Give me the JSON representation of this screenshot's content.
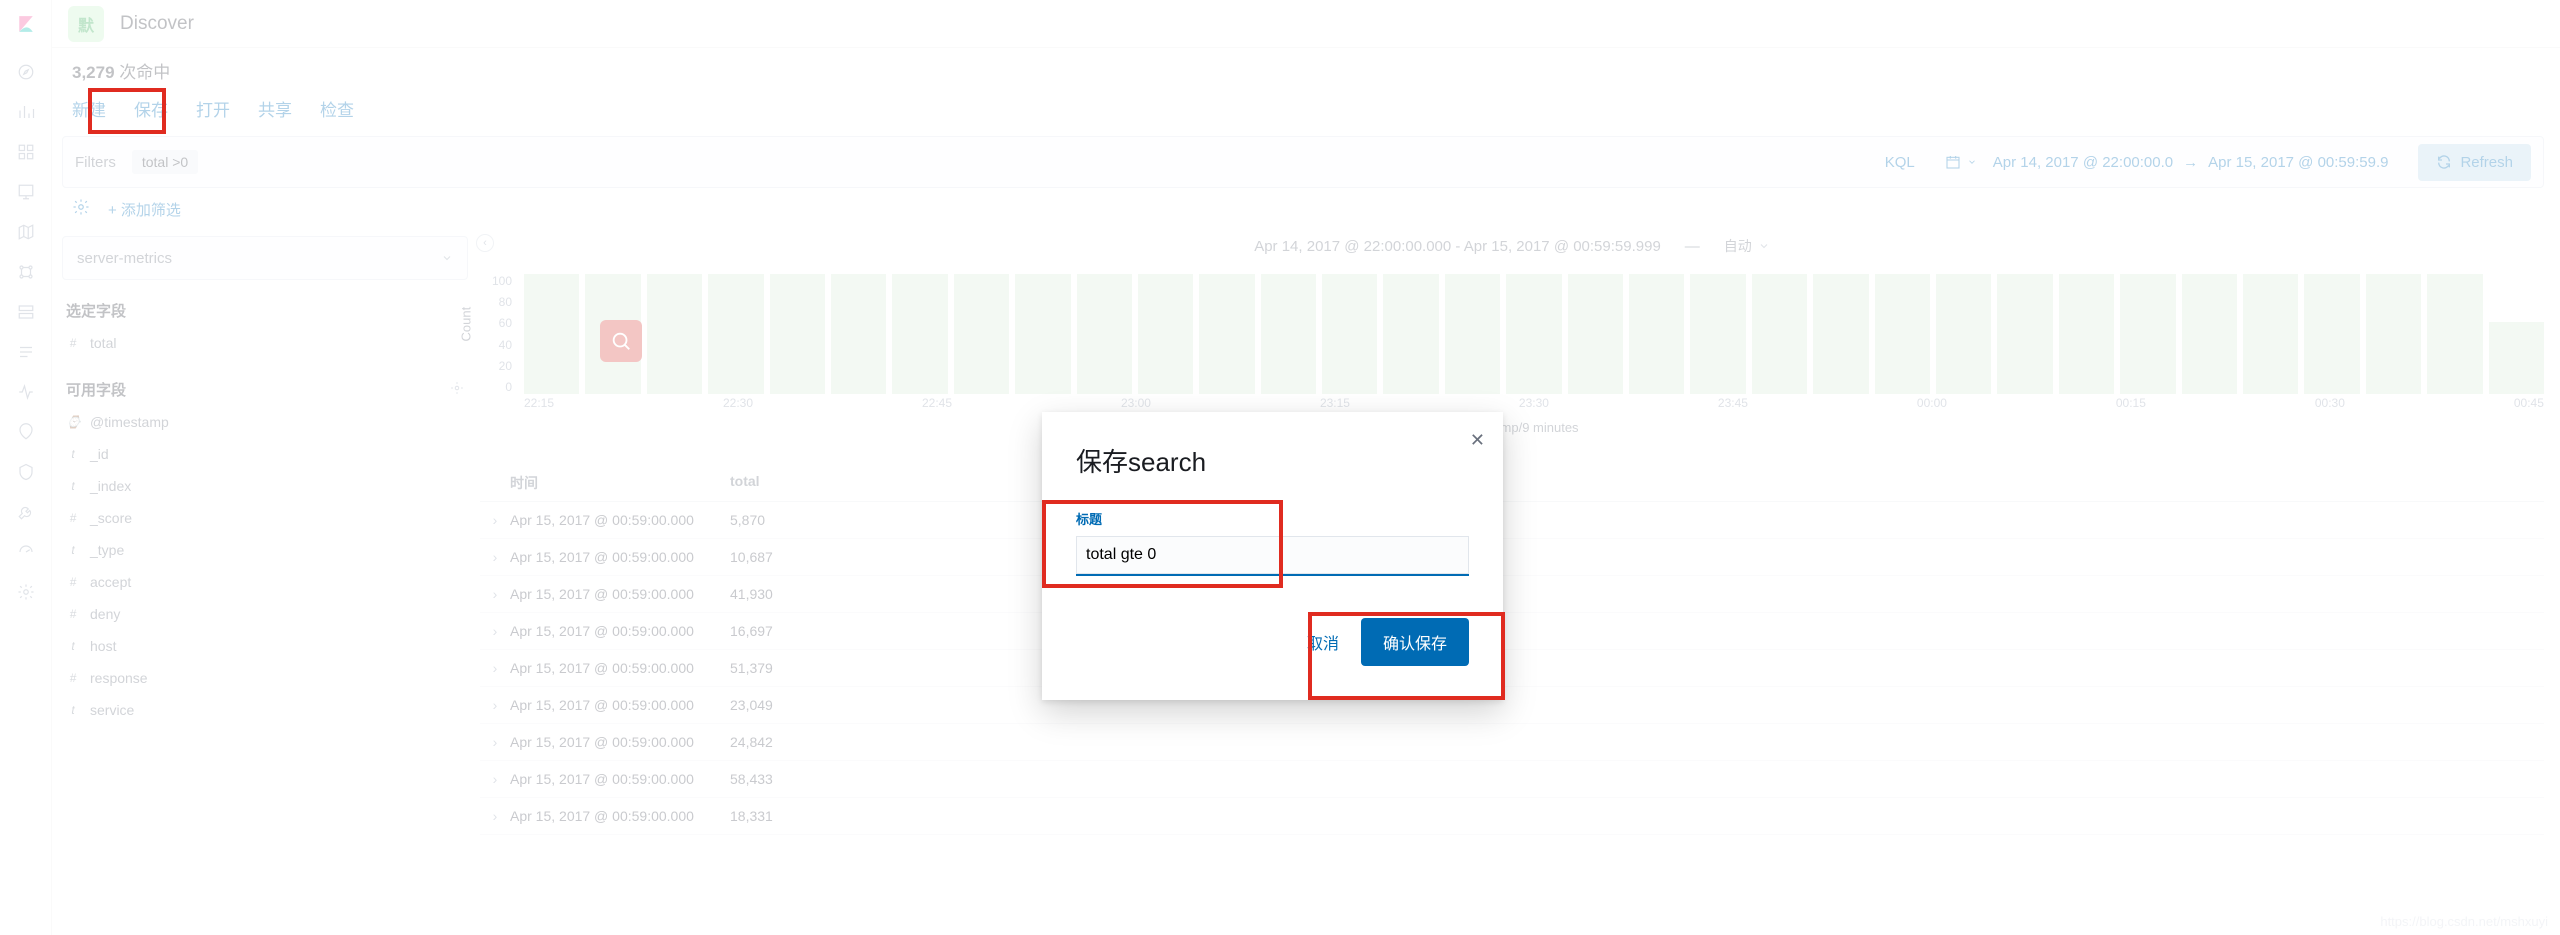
{
  "app": {
    "space": "默",
    "title": "Discover"
  },
  "hits": {
    "count": "3,279",
    "label": "次命中"
  },
  "tabs": [
    "新建",
    "保存",
    "打开",
    "共享",
    "检查"
  ],
  "filterbar": {
    "label": "Filters",
    "pill": "total >0",
    "kql": "KQL",
    "range_from": "Apr 14, 2017 @ 22:00:00.0",
    "range_to": "Apr 15, 2017 @ 00:59:59.9",
    "refresh": "Refresh"
  },
  "addfilter": "+ 添加筛选",
  "indexpattern": "server-metrics",
  "fields": {
    "selected_label": "选定字段",
    "selected": [
      {
        "t": "#",
        "n": "total"
      }
    ],
    "available_label": "可用字段",
    "available": [
      {
        "t": "⌚",
        "n": "@timestamp"
      },
      {
        "t": "t",
        "n": "_id"
      },
      {
        "t": "t",
        "n": "_index"
      },
      {
        "t": "#",
        "n": "_score"
      },
      {
        "t": "t",
        "n": "_type"
      },
      {
        "t": "#",
        "n": "accept"
      },
      {
        "t": "#",
        "n": "deny"
      },
      {
        "t": "t",
        "n": "host"
      },
      {
        "t": "#",
        "n": "response"
      },
      {
        "t": "t",
        "n": "service"
      }
    ]
  },
  "chart_data": {
    "type": "bar",
    "title": "Apr 14, 2017 @ 22:00:00.000 - Apr 15, 2017 @ 00:59:59.999",
    "interval": "自动",
    "ylabel": "Count",
    "xlabel": "@timestamp/9 minutes",
    "yticks": [
      "100",
      "80",
      "60",
      "40",
      "20",
      "0"
    ],
    "xticks": [
      "22:15",
      "22:30",
      "22:45",
      "23:00",
      "23:15",
      "23:30",
      "23:45",
      "00:00",
      "00:15",
      "00:30",
      "00:45"
    ],
    "values": [
      100,
      100,
      100,
      100,
      100,
      100,
      100,
      100,
      100,
      100,
      100,
      100,
      100,
      100,
      100,
      100,
      100,
      100,
      100,
      100,
      100,
      100,
      100,
      100,
      100,
      100,
      100,
      100,
      100,
      100,
      100,
      100,
      60
    ]
  },
  "table": {
    "cols": [
      "时间",
      "total"
    ],
    "rows": [
      [
        "Apr 15, 2017 @ 00:59:00.000",
        "5,870"
      ],
      [
        "Apr 15, 2017 @ 00:59:00.000",
        "10,687"
      ],
      [
        "Apr 15, 2017 @ 00:59:00.000",
        "41,930"
      ],
      [
        "Apr 15, 2017 @ 00:59:00.000",
        "16,697"
      ],
      [
        "Apr 15, 2017 @ 00:59:00.000",
        "51,379"
      ],
      [
        "Apr 15, 2017 @ 00:59:00.000",
        "23,049"
      ],
      [
        "Apr 15, 2017 @ 00:59:00.000",
        "24,842"
      ],
      [
        "Apr 15, 2017 @ 00:59:00.000",
        "58,433"
      ],
      [
        "Apr 15, 2017 @ 00:59:00.000",
        "18,331"
      ]
    ]
  },
  "modal": {
    "title": "保存search",
    "field_label": "标题",
    "value": "total gte 0",
    "cancel": "取消",
    "confirm": "确认保存"
  },
  "watermark": "https://blog.csdn.net/mshxuyi"
}
